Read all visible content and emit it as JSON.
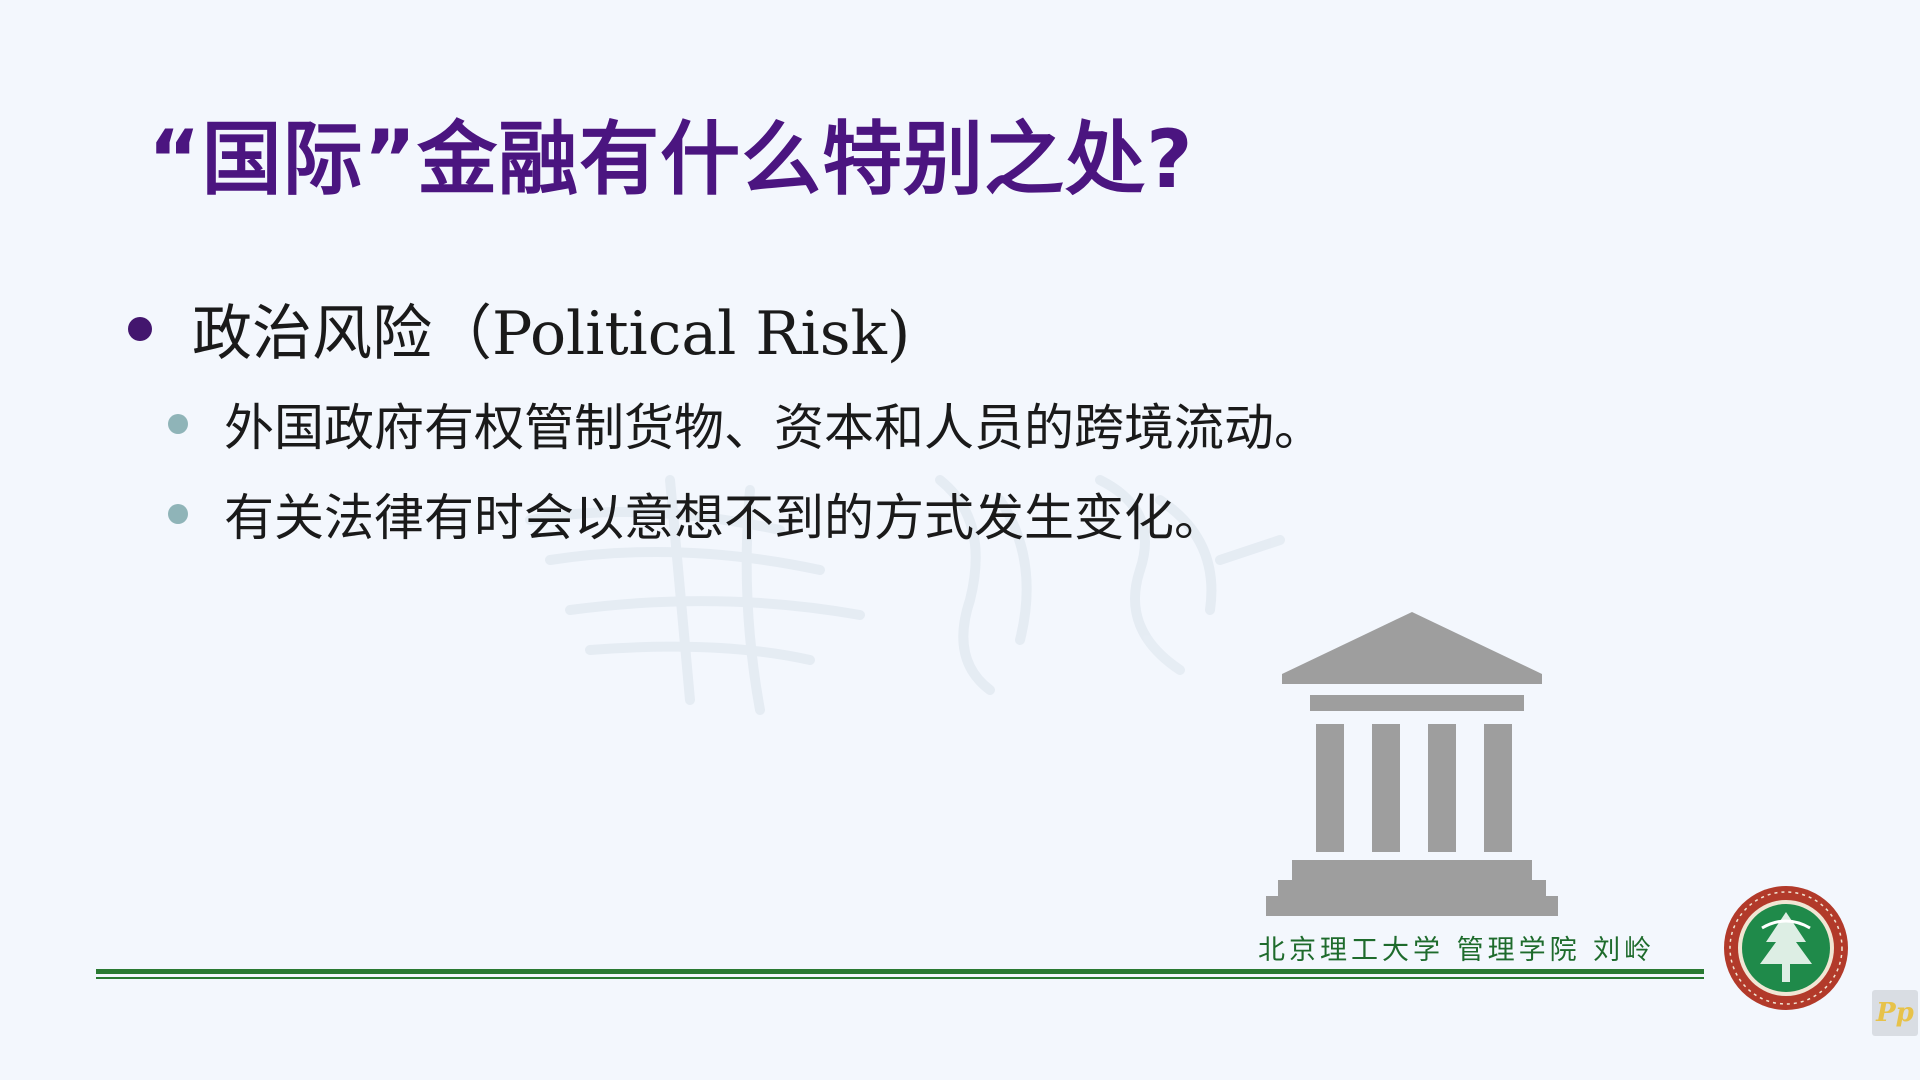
{
  "slide": {
    "title": "“国际”金融有什么特别之处?",
    "bullet": "政治风险（Political Risk)",
    "sub_bullets": [
      "外国政府有权管制货物、资本和人员的跨境流动。",
      "有关法律有时会以意想不到的方式发生变化。"
    ],
    "footer": "北京理工大学 管理学院 刘岭"
  },
  "colors": {
    "background": "#f3f7fd",
    "title": "#4b1580",
    "main_bullet": "#43166e",
    "sub_bullet": "#8fb4b8",
    "footer_line": "#2a7a33",
    "building": "#9e9e9e"
  },
  "icons": {
    "building": "classical-building-icon",
    "university_logo": "university-seal-logo",
    "overlay": "pp-overlay-icon"
  }
}
